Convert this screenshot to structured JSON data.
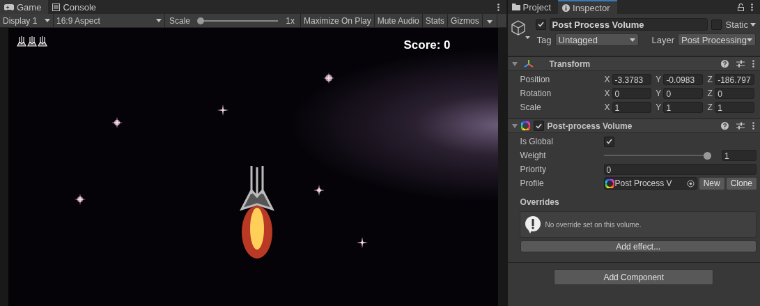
{
  "game_panel": {
    "tabs": [
      {
        "label": "Game",
        "selected": true
      },
      {
        "label": "Console",
        "selected": false
      }
    ],
    "toolbar": {
      "display": "Display 1",
      "aspect": "16:9 Aspect",
      "scale_label": "Scale",
      "scale_slider": {
        "level": 0
      },
      "scale_value": "1x",
      "buttons": [
        {
          "label": "Maximize On Play",
          "selected": false
        },
        {
          "label": "Mute Audio",
          "selected": false
        },
        {
          "label": "Stats",
          "selected": false
        },
        {
          "label": "Gizmos",
          "selected": false
        }
      ]
    },
    "game": {
      "score": "Score: 0"
    }
  },
  "inspector": {
    "tabs": [
      {
        "label": "Project",
        "selected": false
      },
      {
        "label": "Inspector",
        "selected": true
      }
    ],
    "header": {
      "active": true,
      "name": "Post Process Volume",
      "static": false,
      "static_label": "Static",
      "tag_label": "Tag",
      "tag": "Untagged",
      "layer_label": "Layer",
      "layer": "Post Processing"
    },
    "components": [
      {
        "kind": "transform",
        "title": "Transform",
        "expanded": true,
        "rows": [
          {
            "label": "Position",
            "fields": [
              {
                "axis": "X",
                "value": "-3.3783"
              },
              {
                "axis": "Y",
                "value": "-0.0983"
              },
              {
                "axis": "Z",
                "value": "-186.797"
              }
            ]
          },
          {
            "label": "Rotation",
            "fields": [
              {
                "axis": "X",
                "value": "0"
              },
              {
                "axis": "Y",
                "value": "0"
              },
              {
                "axis": "Z",
                "value": "0"
              }
            ]
          },
          {
            "label": "Scale",
            "fields": [
              {
                "axis": "X",
                "value": "1"
              },
              {
                "axis": "Y",
                "value": "1"
              },
              {
                "axis": "Z",
                "value": "1"
              }
            ]
          }
        ]
      },
      {
        "kind": "volume",
        "title": "Post-process Volume",
        "expanded": true,
        "enabled": true,
        "properties": [
          {
            "kind": "checkbox",
            "label": "Is Global",
            "checked": true
          },
          {
            "kind": "slider",
            "label": "Weight",
            "level": 1,
            "value": "1"
          },
          {
            "kind": "number",
            "label": "Priority",
            "value": "0"
          },
          {
            "kind": "object",
            "label": "Profile",
            "value": "Post Process V",
            "buttons": [
              "New",
              "Clone"
            ]
          }
        ],
        "overrides": {
          "title": "Overrides",
          "message": "No override set on this volume.",
          "button": "Add effect..."
        }
      }
    ],
    "add_component": "Add Component"
  }
}
